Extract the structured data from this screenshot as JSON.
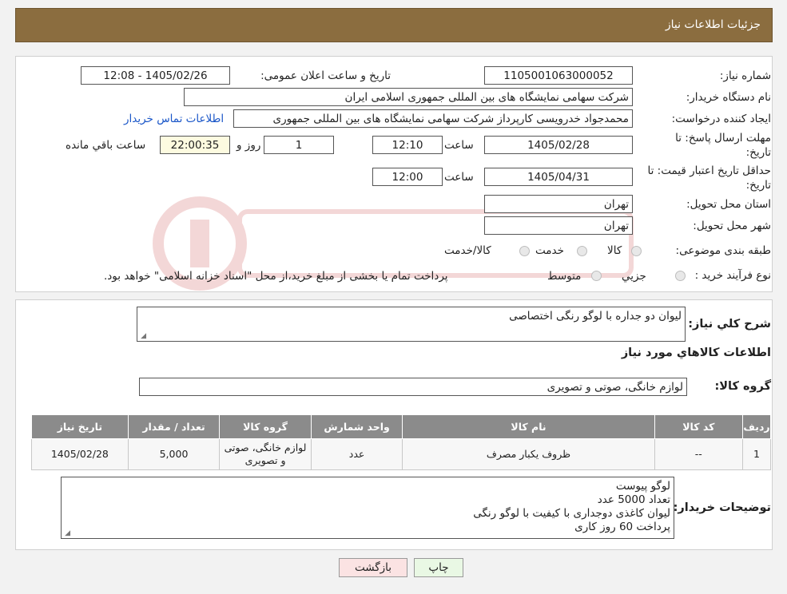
{
  "header": {
    "title": "جزئیات اطلاعات نیاز"
  },
  "form": {
    "need_number_label": "شماره نیاز:",
    "need_number": "1105001063000052",
    "announce_label": "تاریخ و ساعت اعلان عمومی:",
    "announce_value": "1405/02/26 - 12:08",
    "buyer_label": "نام دستگاه خریدار:",
    "buyer_value": "شرکت سهامی نمایشگاه های بین المللی جمهوری اسلامی ایران",
    "creator_label": "ایجاد کننده درخواست:",
    "creator_value": "محمدجواد خدرویسی کارپرداز شرکت سهامی نمایشگاه های بین المللی جمهوری",
    "contact_link": "اطلاعات تماس خریدار",
    "deadline_label_1": "مهلت ارسال پاسخ: تا",
    "deadline_label_2": "تاریخ:",
    "deadline_date": "1405/02/28",
    "time_label": "ساعت",
    "deadline_time": "12:10",
    "days_value": "1",
    "days_label": "روز و",
    "remaining_time": "22:00:35",
    "remaining_label": "ساعت باقي مانده",
    "validity_label_1": "حداقل تاریخ اعتبار قیمت: تا",
    "validity_label_2": "تاریخ:",
    "validity_date": "1405/04/31",
    "validity_time": "12:00",
    "province_label": "استان محل تحویل:",
    "province_value": "تهران",
    "city_label": "شهر محل تحویل:",
    "city_value": "تهران",
    "category_label": "طبقه بندی موضوعی:",
    "category_options": [
      "کالا",
      "خدمت",
      "کالا/خدمت"
    ],
    "purchase_type_label": "نوع فرآیند خرید :",
    "purchase_options": [
      "جزیي",
      "متوسط"
    ],
    "purchase_note": "پرداخت تمام یا بخشی از مبلغ خرید،از محل \"اسناد خزانه اسلامی\" خواهد بود."
  },
  "summary": {
    "desc_label": "شرح کلي نياز:",
    "desc_value": "لیوان دو جداره با لوگو رنگی اختصاصی",
    "goods_info_title": "اطلاعات کالاهاي مورد نياز",
    "group_label": "گروه کالا:",
    "group_value": "لوازم خانگی، صوتی و تصویری"
  },
  "table": {
    "headers": [
      "رديف",
      "کد کالا",
      "نام کالا",
      "واحد شمارش",
      "گروه کالا",
      "تعداد / مقدار",
      "تاريخ نياز"
    ],
    "rows": [
      {
        "row": "1",
        "code": "--",
        "name": "ظروف یکبار مصرف",
        "unit": "عدد",
        "group": "لوازم خانگی، صوتی و تصویری",
        "qty": "5,000",
        "date": "1405/02/28"
      }
    ]
  },
  "buyer_notes": {
    "label": "توضیحات خریدار:",
    "lines": [
      "لوگو پیوست",
      "تعداد 5000 عدد",
      "لیوان کاغذی دوجداری با کیفیت با لوگو رنگی",
      "پرداخت 60 روز کاری"
    ]
  },
  "buttons": {
    "print": "چاپ",
    "back": "بازگشت"
  },
  "colors": {
    "header_bg": "#8b6d3f",
    "table_header": "#8b8b8b",
    "link": "#1a56c8",
    "print_btn": "#e9f8e4",
    "back_btn": "#fbe3e3"
  }
}
